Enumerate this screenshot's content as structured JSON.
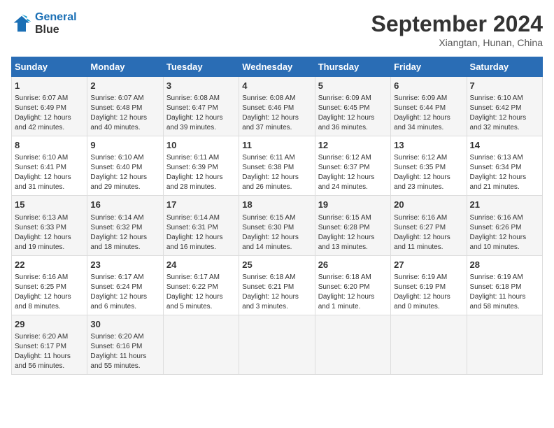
{
  "header": {
    "logo_line1": "General",
    "logo_line2": "Blue",
    "month": "September 2024",
    "location": "Xiangtan, Hunan, China"
  },
  "days_of_week": [
    "Sunday",
    "Monday",
    "Tuesday",
    "Wednesday",
    "Thursday",
    "Friday",
    "Saturday"
  ],
  "weeks": [
    [
      {
        "day": "1",
        "info": "Sunrise: 6:07 AM\nSunset: 6:49 PM\nDaylight: 12 hours\nand 42 minutes."
      },
      {
        "day": "2",
        "info": "Sunrise: 6:07 AM\nSunset: 6:48 PM\nDaylight: 12 hours\nand 40 minutes."
      },
      {
        "day": "3",
        "info": "Sunrise: 6:08 AM\nSunset: 6:47 PM\nDaylight: 12 hours\nand 39 minutes."
      },
      {
        "day": "4",
        "info": "Sunrise: 6:08 AM\nSunset: 6:46 PM\nDaylight: 12 hours\nand 37 minutes."
      },
      {
        "day": "5",
        "info": "Sunrise: 6:09 AM\nSunset: 6:45 PM\nDaylight: 12 hours\nand 36 minutes."
      },
      {
        "day": "6",
        "info": "Sunrise: 6:09 AM\nSunset: 6:44 PM\nDaylight: 12 hours\nand 34 minutes."
      },
      {
        "day": "7",
        "info": "Sunrise: 6:10 AM\nSunset: 6:42 PM\nDaylight: 12 hours\nand 32 minutes."
      }
    ],
    [
      {
        "day": "8",
        "info": "Sunrise: 6:10 AM\nSunset: 6:41 PM\nDaylight: 12 hours\nand 31 minutes."
      },
      {
        "day": "9",
        "info": "Sunrise: 6:10 AM\nSunset: 6:40 PM\nDaylight: 12 hours\nand 29 minutes."
      },
      {
        "day": "10",
        "info": "Sunrise: 6:11 AM\nSunset: 6:39 PM\nDaylight: 12 hours\nand 28 minutes."
      },
      {
        "day": "11",
        "info": "Sunrise: 6:11 AM\nSunset: 6:38 PM\nDaylight: 12 hours\nand 26 minutes."
      },
      {
        "day": "12",
        "info": "Sunrise: 6:12 AM\nSunset: 6:37 PM\nDaylight: 12 hours\nand 24 minutes."
      },
      {
        "day": "13",
        "info": "Sunrise: 6:12 AM\nSunset: 6:35 PM\nDaylight: 12 hours\nand 23 minutes."
      },
      {
        "day": "14",
        "info": "Sunrise: 6:13 AM\nSunset: 6:34 PM\nDaylight: 12 hours\nand 21 minutes."
      }
    ],
    [
      {
        "day": "15",
        "info": "Sunrise: 6:13 AM\nSunset: 6:33 PM\nDaylight: 12 hours\nand 19 minutes."
      },
      {
        "day": "16",
        "info": "Sunrise: 6:14 AM\nSunset: 6:32 PM\nDaylight: 12 hours\nand 18 minutes."
      },
      {
        "day": "17",
        "info": "Sunrise: 6:14 AM\nSunset: 6:31 PM\nDaylight: 12 hours\nand 16 minutes."
      },
      {
        "day": "18",
        "info": "Sunrise: 6:15 AM\nSunset: 6:30 PM\nDaylight: 12 hours\nand 14 minutes."
      },
      {
        "day": "19",
        "info": "Sunrise: 6:15 AM\nSunset: 6:28 PM\nDaylight: 12 hours\nand 13 minutes."
      },
      {
        "day": "20",
        "info": "Sunrise: 6:16 AM\nSunset: 6:27 PM\nDaylight: 12 hours\nand 11 minutes."
      },
      {
        "day": "21",
        "info": "Sunrise: 6:16 AM\nSunset: 6:26 PM\nDaylight: 12 hours\nand 10 minutes."
      }
    ],
    [
      {
        "day": "22",
        "info": "Sunrise: 6:16 AM\nSunset: 6:25 PM\nDaylight: 12 hours\nand 8 minutes."
      },
      {
        "day": "23",
        "info": "Sunrise: 6:17 AM\nSunset: 6:24 PM\nDaylight: 12 hours\nand 6 minutes."
      },
      {
        "day": "24",
        "info": "Sunrise: 6:17 AM\nSunset: 6:22 PM\nDaylight: 12 hours\nand 5 minutes."
      },
      {
        "day": "25",
        "info": "Sunrise: 6:18 AM\nSunset: 6:21 PM\nDaylight: 12 hours\nand 3 minutes."
      },
      {
        "day": "26",
        "info": "Sunrise: 6:18 AM\nSunset: 6:20 PM\nDaylight: 12 hours\nand 1 minute."
      },
      {
        "day": "27",
        "info": "Sunrise: 6:19 AM\nSunset: 6:19 PM\nDaylight: 12 hours\nand 0 minutes."
      },
      {
        "day": "28",
        "info": "Sunrise: 6:19 AM\nSunset: 6:18 PM\nDaylight: 11 hours\nand 58 minutes."
      }
    ],
    [
      {
        "day": "29",
        "info": "Sunrise: 6:20 AM\nSunset: 6:17 PM\nDaylight: 11 hours\nand 56 minutes."
      },
      {
        "day": "30",
        "info": "Sunrise: 6:20 AM\nSunset: 6:16 PM\nDaylight: 11 hours\nand 55 minutes."
      },
      {
        "day": "",
        "info": ""
      },
      {
        "day": "",
        "info": ""
      },
      {
        "day": "",
        "info": ""
      },
      {
        "day": "",
        "info": ""
      },
      {
        "day": "",
        "info": ""
      }
    ]
  ]
}
